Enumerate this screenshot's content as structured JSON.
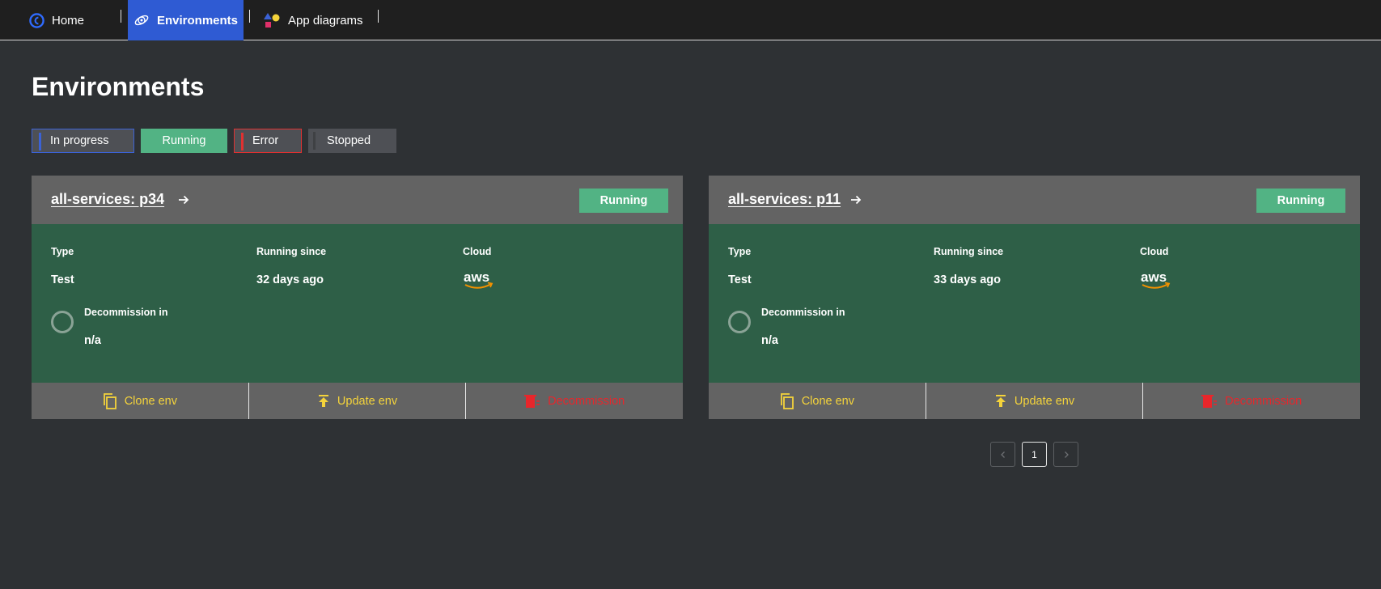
{
  "nav": {
    "home": "Home",
    "environments": "Environments",
    "app_diagrams": "App diagrams"
  },
  "page": {
    "title": "Environments"
  },
  "filters": {
    "in_progress": "In progress",
    "running": "Running",
    "error": "Error",
    "stopped": "Stopped"
  },
  "labels": {
    "type": "Type",
    "running_since": "Running since",
    "cloud": "Cloud",
    "decommission_in": "Decommission in",
    "clone": "Clone env",
    "update": "Update env",
    "decommission": "Decommission"
  },
  "environments": [
    {
      "name": "all-services: p34",
      "status": "Running",
      "type": "Test",
      "running_since": "32 days ago",
      "cloud": "aws",
      "decommission_in": "n/a"
    },
    {
      "name": "all-services: p11",
      "status": "Running",
      "type": "Test",
      "running_since": "33 days ago",
      "cloud": "aws",
      "decommission_in": "n/a"
    }
  ],
  "pagination": {
    "current": "1",
    "prev_icon": "chevron-left-icon",
    "next_icon": "chevron-right-icon"
  },
  "colors": {
    "nav_active": "#2f5bd3",
    "running": "#52b384",
    "card_body": "#2e5f47",
    "action": "#f4d33b",
    "danger": "#e8262b",
    "aws_orange": "#f29100"
  }
}
